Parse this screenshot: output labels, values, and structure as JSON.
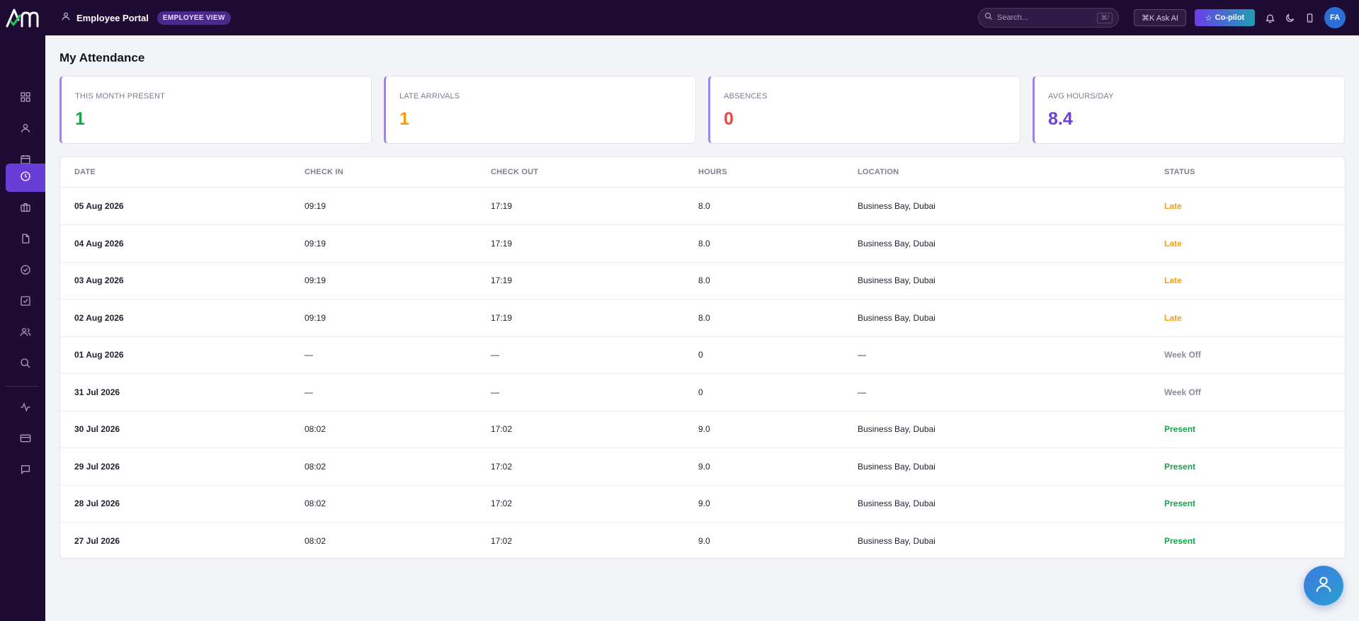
{
  "header": {
    "portal_title": "Employee Portal",
    "view_badge": "EMPLOYEE VIEW",
    "search_placeholder": "Search...",
    "search_shortcut": "⌘/",
    "ask_ai_label": "⌘K Ask AI",
    "copilot_label": "Co-pilot",
    "avatar_initials": "FA"
  },
  "sidebar": {
    "items": [
      {
        "icon": "grid-icon"
      },
      {
        "icon": "user-icon"
      },
      {
        "icon": "calendar-icon"
      },
      {
        "icon": "clock-icon",
        "active": true
      },
      {
        "icon": "briefcase-icon"
      },
      {
        "icon": "document-icon"
      },
      {
        "icon": "check-circle-icon"
      },
      {
        "icon": "checkbox-icon"
      },
      {
        "icon": "users-icon"
      },
      {
        "icon": "search-icon"
      },
      {
        "icon": "activity-icon"
      },
      {
        "icon": "card-icon"
      },
      {
        "icon": "message-icon"
      }
    ]
  },
  "page": {
    "title": "My Attendance"
  },
  "stats": [
    {
      "label": "THIS MONTH PRESENT",
      "value": "1",
      "color": "#16a34a"
    },
    {
      "label": "LATE ARRIVALS",
      "value": "1",
      "color": "#f59e0b"
    },
    {
      "label": "ABSENCES",
      "value": "0",
      "color": "#ef4444"
    },
    {
      "label": "AVG HOURS/DAY",
      "value": "8.4",
      "color": "#6d3ee0"
    }
  ],
  "table": {
    "columns": [
      "DATE",
      "CHECK IN",
      "CHECK OUT",
      "HOURS",
      "LOCATION",
      "STATUS"
    ],
    "rows": [
      {
        "date": "05 Aug 2026",
        "check_in": "09:19",
        "check_out": "17:19",
        "hours": "8.0",
        "location": "Business Bay, Dubai",
        "status": "Late"
      },
      {
        "date": "04 Aug 2026",
        "check_in": "09:19",
        "check_out": "17:19",
        "hours": "8.0",
        "location": "Business Bay, Dubai",
        "status": "Late"
      },
      {
        "date": "03 Aug 2026",
        "check_in": "09:19",
        "check_out": "17:19",
        "hours": "8.0",
        "location": "Business Bay, Dubai",
        "status": "Late"
      },
      {
        "date": "02 Aug 2026",
        "check_in": "09:19",
        "check_out": "17:19",
        "hours": "8.0",
        "location": "Business Bay, Dubai",
        "status": "Late"
      },
      {
        "date": "01 Aug 2026",
        "check_in": "—",
        "check_out": "—",
        "hours": "0",
        "location": "—",
        "status": "Week Off"
      },
      {
        "date": "31 Jul 2026",
        "check_in": "—",
        "check_out": "—",
        "hours": "0",
        "location": "—",
        "status": "Week Off"
      },
      {
        "date": "30 Jul 2026",
        "check_in": "08:02",
        "check_out": "17:02",
        "hours": "9.0",
        "location": "Business Bay, Dubai",
        "status": "Present"
      },
      {
        "date": "29 Jul 2026",
        "check_in": "08:02",
        "check_out": "17:02",
        "hours": "9.0",
        "location": "Business Bay, Dubai",
        "status": "Present"
      },
      {
        "date": "28 Jul 2026",
        "check_in": "08:02",
        "check_out": "17:02",
        "hours": "9.0",
        "location": "Business Bay, Dubai",
        "status": "Present"
      },
      {
        "date": "27 Jul 2026",
        "check_in": "08:02",
        "check_out": "17:02",
        "hours": "9.0",
        "location": "Business Bay, Dubai",
        "status": "Present"
      }
    ]
  },
  "status_colors": {
    "Late": "#f59e0b",
    "Week Off": "#8a8d99",
    "Present": "#16a34a"
  }
}
